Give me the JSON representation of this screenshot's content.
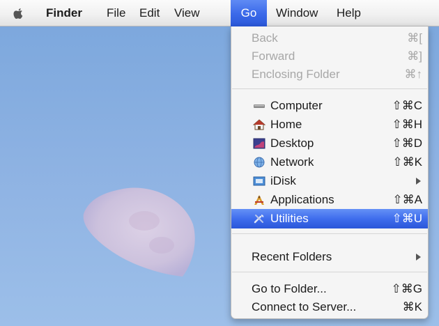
{
  "menubar": {
    "items": [
      "Finder",
      "File",
      "Edit",
      "View",
      "Go",
      "Window",
      "Help"
    ],
    "active": "Go"
  },
  "go_menu": {
    "nav_items": [
      {
        "label": "Back",
        "shortcut": "⌘[",
        "enabled": false
      },
      {
        "label": "Forward",
        "shortcut": "⌘]",
        "enabled": false
      },
      {
        "label": "Enclosing Folder",
        "shortcut": "⌘↑",
        "enabled": false
      }
    ],
    "places": [
      {
        "label": "Computer",
        "shortcut": "⇧⌘C",
        "icon": "computer-icon"
      },
      {
        "label": "Home",
        "shortcut": "⇧⌘H",
        "icon": "home-icon"
      },
      {
        "label": "Desktop",
        "shortcut": "⇧⌘D",
        "icon": "desktop-icon"
      },
      {
        "label": "Network",
        "shortcut": "⇧⌘K",
        "icon": "network-icon"
      },
      {
        "label": "iDisk",
        "shortcut": "",
        "icon": "idisk-icon",
        "submenu": true
      },
      {
        "label": "Applications",
        "shortcut": "⇧⌘A",
        "icon": "applications-icon"
      },
      {
        "label": "Utilities",
        "shortcut": "⇧⌘U",
        "icon": "utilities-icon",
        "selected": true
      }
    ],
    "recent": {
      "label": "Recent Folders",
      "submenu": true
    },
    "goto_items": [
      {
        "label": "Go to Folder...",
        "shortcut": "⇧⌘G"
      },
      {
        "label": "Connect to Server...",
        "shortcut": "⌘K"
      }
    ]
  },
  "colors": {
    "highlight": "#3d6bea",
    "desktop_sky": "#8fb3e3",
    "menu_bg": "#f5f5f5"
  }
}
